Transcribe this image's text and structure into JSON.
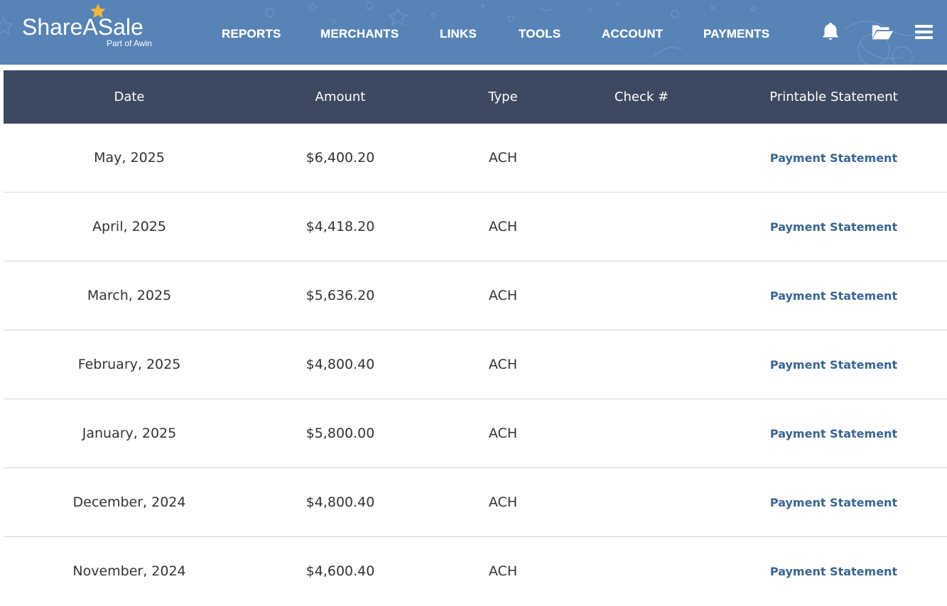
{
  "brand": {
    "name": "ShareASale",
    "tagline": "Part of Awin"
  },
  "nav": {
    "items": [
      {
        "label": "REPORTS"
      },
      {
        "label": "MERCHANTS"
      },
      {
        "label": "LINKS"
      },
      {
        "label": "TOOLS"
      },
      {
        "label": "ACCOUNT"
      },
      {
        "label": "PAYMENTS"
      }
    ],
    "icons": [
      "bell-icon",
      "folder-open-icon",
      "hamburger-menu-icon"
    ]
  },
  "colors": {
    "nav_bg": "#5783b6",
    "table_header_bg": "#3c4960",
    "link": "#3a6496",
    "logo_star": "#f4b63f"
  },
  "table": {
    "columns": [
      "Date",
      "Amount",
      "Type",
      "Check #",
      "Printable Statement"
    ],
    "rows": [
      {
        "date": "May, 2025",
        "amount": "$6,400.20",
        "type": "ACH",
        "check": "",
        "statement": "Payment Statement"
      },
      {
        "date": "April, 2025",
        "amount": "$4,418.20",
        "type": "ACH",
        "check": "",
        "statement": "Payment Statement"
      },
      {
        "date": "March, 2025",
        "amount": "$5,636.20",
        "type": "ACH",
        "check": "",
        "statement": "Payment Statement"
      },
      {
        "date": "February, 2025",
        "amount": "$4,800.40",
        "type": "ACH",
        "check": "",
        "statement": "Payment Statement"
      },
      {
        "date": "January, 2025",
        "amount": "$5,800.00",
        "type": "ACH",
        "check": "",
        "statement": "Payment Statement"
      },
      {
        "date": "December, 2024",
        "amount": "$4,800.40",
        "type": "ACH",
        "check": "",
        "statement": "Payment Statement"
      },
      {
        "date": "November, 2024",
        "amount": "$4,600.40",
        "type": "ACH",
        "check": "",
        "statement": "Payment Statement"
      }
    ]
  }
}
